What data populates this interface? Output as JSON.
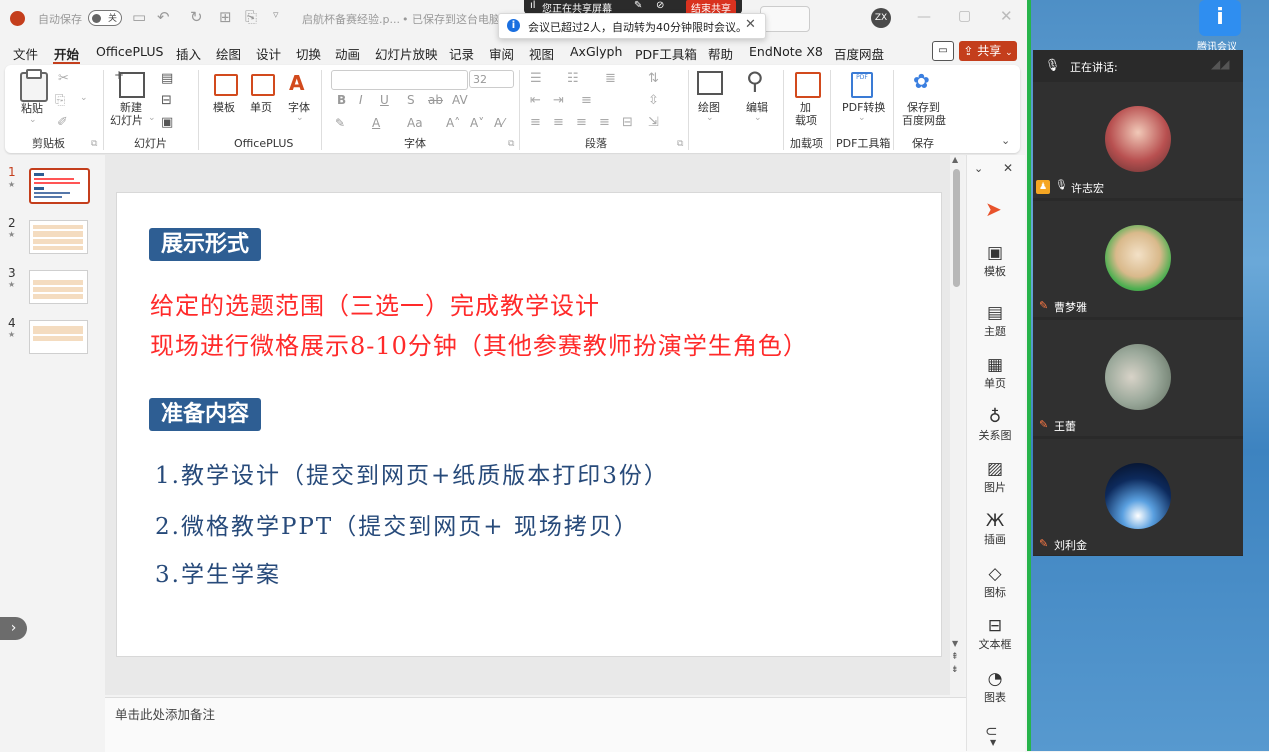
{
  "titlebar": {
    "autosave_label": "自动保存",
    "toggle_text": "关",
    "filename": "启航杯备赛经验.p...",
    "save_state": "• 已保存到这台电脑",
    "avatar_initials": "ZX"
  },
  "share_bar": {
    "sharing_text": "您正在共享屏幕",
    "end_button": "结束共享"
  },
  "toast": {
    "message": "会议已超过2人，自动转为40分钟限时会议。"
  },
  "menu": {
    "items": [
      "文件",
      "开始",
      "OfficePLUS",
      "插入",
      "绘图",
      "设计",
      "切换",
      "动画",
      "幻灯片放映",
      "记录",
      "审阅",
      "视图",
      "AxGlyph",
      "PDF工具箱",
      "帮助",
      "EndNote X8",
      "百度网盘"
    ],
    "active": "开始",
    "share_button": "共享"
  },
  "ribbon": {
    "groups": {
      "clipboard": "剪贴板",
      "slides": "幻灯片",
      "officeplus": "OfficePLUS",
      "font": "字体",
      "paragraph": "段落",
      "addins": "加载项",
      "pdf": "PDF工具箱",
      "save": "保存"
    },
    "paste": "粘贴",
    "new_slide_1": "新建",
    "new_slide_2": "幻灯片",
    "template": "模板",
    "single_page": "单页",
    "font_btn": "字体",
    "font_size": "32",
    "drawing": "绘图",
    "editing": "编辑",
    "addin_1": "加",
    "addin_2": "载项",
    "pdf_convert": "PDF转换",
    "save_to_1": "保存到",
    "save_to_2": "百度网盘"
  },
  "thumbnails": [
    "1",
    "2",
    "3",
    "4"
  ],
  "slide": {
    "heading1": "展示形式",
    "line1": "给定的选题范围（三选一）完成教学设计",
    "line2": "现场进行微格展示8-10分钟（其他参赛教师扮演学生角色）",
    "heading2": "准备内容",
    "item1": "1.教学设计（提交到网页+纸质版本打印3份）",
    "item2": "2.微格教学PPT（提交到网页+ 现场拷贝）",
    "item3": "3.学生学案"
  },
  "notes_placeholder": "单击此处添加备注",
  "right_panel": [
    "模板",
    "主题",
    "单页",
    "关系图",
    "图片",
    "插画",
    "图标",
    "文本框",
    "图表"
  ],
  "meeting": {
    "speaking_label": "正在讲话:",
    "participants": [
      "许志宏",
      "曹梦雅",
      "王蕾",
      "刘利金"
    ],
    "desktop_icon_label": "腾讯会议"
  }
}
